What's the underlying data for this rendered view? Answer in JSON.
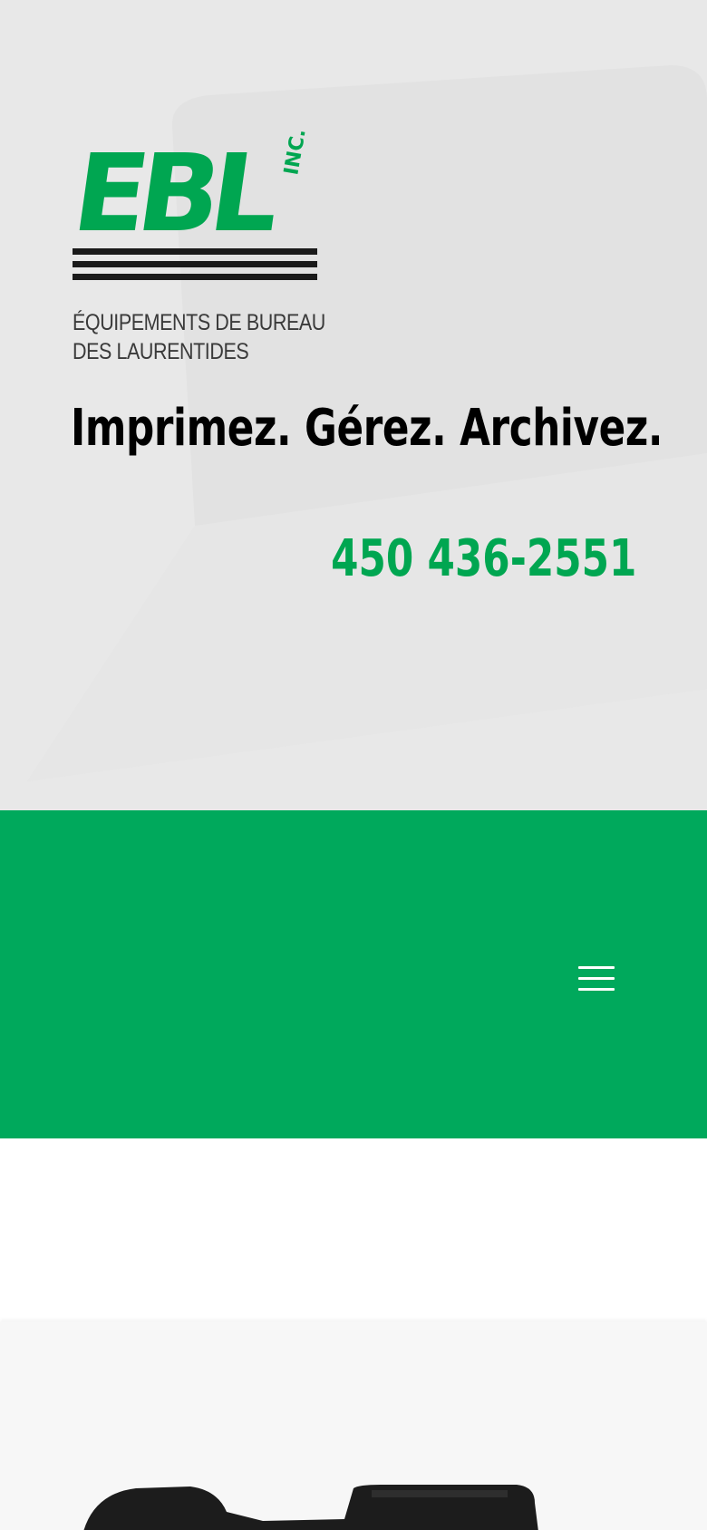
{
  "brand": {
    "logo_text": "EBL",
    "logo_inc": "INC.",
    "subtitle_line1": "ÉQUIPEMENTS DE BUREAU",
    "subtitle_line2": "DES LAURENTIDES"
  },
  "header": {
    "tagline": "Imprimez. Gérez. Archivez.",
    "phone": "450 436-2551"
  },
  "nav": {
    "menu_icon": "hamburger-menu-icon"
  },
  "product": {
    "image_icon": "printer-image"
  },
  "colors": {
    "brand_green": "#00a651",
    "nav_green": "#00a95c",
    "header_bg": "#e8e8e8",
    "text_dark": "#000000"
  }
}
